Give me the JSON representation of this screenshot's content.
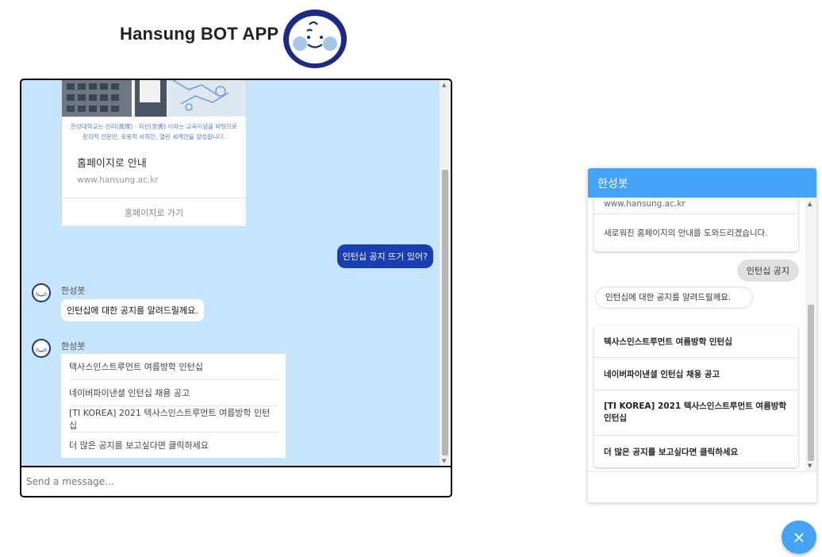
{
  "header": {
    "title": "Hansung BOT APP",
    "logo_icon": "bot-face-logo"
  },
  "main_chat": {
    "website_card": {
      "caption": "한성대학교는 진리(眞理) · 지선(至善) 이라는 교육이념을 바탕으로 창의적 전문인, 포용적 사회인, 열린 세계인을 양성합니다.",
      "title": "홈페이지로 안내",
      "url": "www.hansung.ac.kr",
      "button_label": "홈페이지로 가기"
    },
    "user_message": "인턴십 공지 뜨거 있어?",
    "bot_name": "한성봇",
    "bot_reply": "인턴십에 대한 공지를 알려드릴께요.",
    "bot_list": [
      "텍사스인스트루먼트 여름방학 인턴십",
      "네이버파이낸셜 인턴십 채용 공고",
      "[TI KOREA] 2021 텍사스인스트루먼트 여름방학 인턴십",
      "더 많은 공지를 보고싶다면 클릭하세요"
    ],
    "input_placeholder": "Send a message..."
  },
  "widget": {
    "title": "한성봇",
    "top_card": {
      "url": "www.hansung.ac.kr",
      "text": "새로워진 홈페이지의 안내를 도와드리겠습니다."
    },
    "user_chip": "인턴십 공지",
    "bot_reply": "인턴십에 대한 공지를 알려드릴께요.",
    "list": [
      "텍사스인스트루먼트 여름방학 인턴십",
      "네이버파이낸셜 인턴십 채용 공고",
      "[TI KOREA] 2021 텍사스인스트루먼트 여름방학 인턴십",
      "더 많은 공지를 보고싶다면 클릭하세요"
    ]
  },
  "fab": {
    "icon": "close-icon",
    "glyph": "×"
  },
  "colors": {
    "chat_bg": "#c6e4fb",
    "user_bubble": "#1a3db1",
    "widget_header": "#44a3f4"
  }
}
